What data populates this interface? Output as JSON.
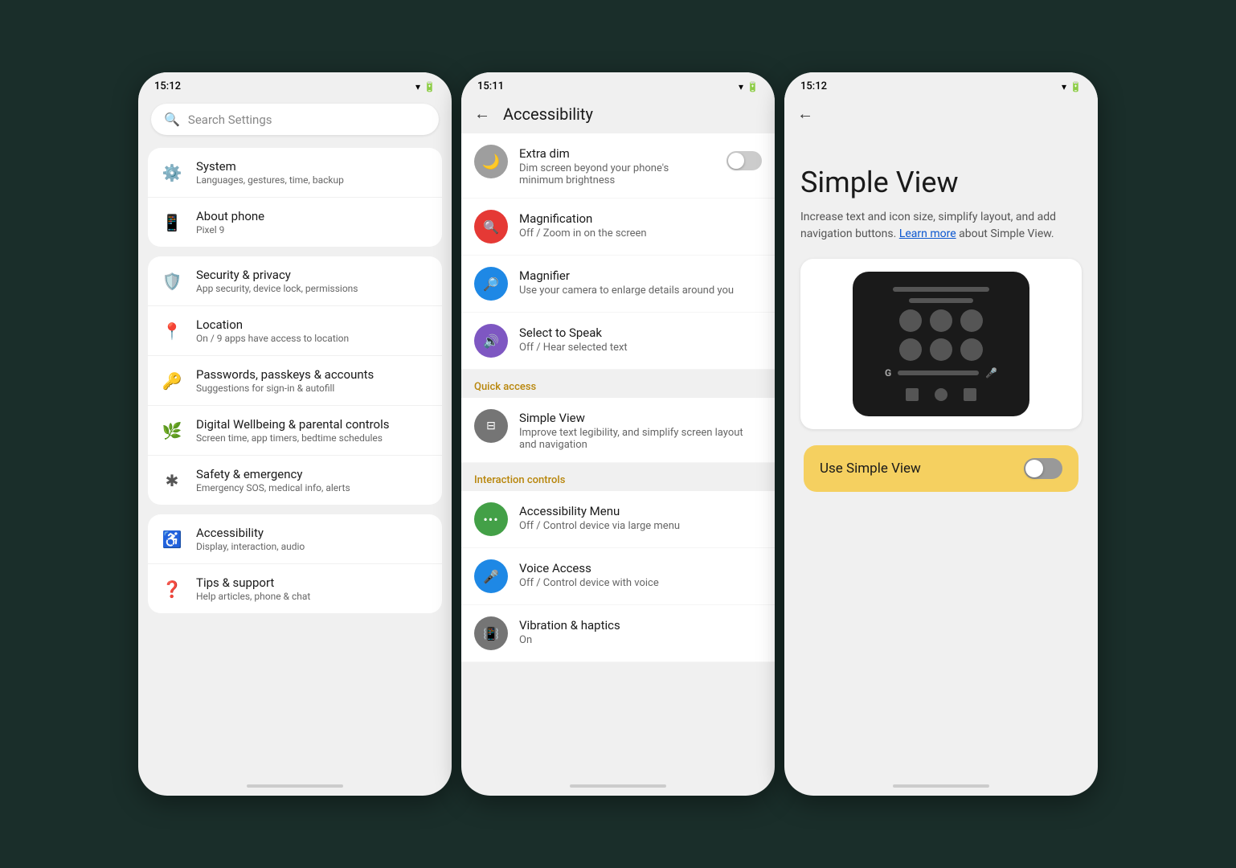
{
  "phone1": {
    "status_time": "15:12",
    "search_placeholder": "Search Settings",
    "items_group1": [
      {
        "icon": "⚙",
        "title": "System",
        "subtitle": "Languages, gestures, time, backup"
      },
      {
        "icon": "📱",
        "title": "About phone",
        "subtitle": "Pixel 9"
      }
    ],
    "items_group2": [
      {
        "icon": "🛡",
        "title": "Security & privacy",
        "subtitle": "App security, device lock, permissions"
      },
      {
        "icon": "📍",
        "title": "Location",
        "subtitle": "On / 9 apps have access to location"
      },
      {
        "icon": "🔑",
        "title": "Passwords, passkeys & accounts",
        "subtitle": "Suggestions for sign-in & autofill"
      },
      {
        "icon": "💚",
        "title": "Digital Wellbeing & parental controls",
        "subtitle": "Screen time, app timers, bedtime schedules"
      },
      {
        "icon": "✱",
        "title": "Safety & emergency",
        "subtitle": "Emergency SOS, medical info, alerts"
      }
    ],
    "items_group3": [
      {
        "icon": "♿",
        "title": "Accessibility",
        "subtitle": "Display, interaction, audio"
      },
      {
        "icon": "❓",
        "title": "Tips & support",
        "subtitle": "Help articles, phone & chat"
      }
    ]
  },
  "phone2": {
    "status_time": "15:11",
    "back_label": "←",
    "page_title": "Accessibility",
    "items": [
      {
        "icon": "🌙",
        "icon_bg": "#9e9e9e",
        "title": "Extra dim",
        "subtitle": "Dim screen beyond your phone's minimum brightness",
        "has_toggle": true,
        "toggle_state": "off"
      },
      {
        "icon": "🔍",
        "icon_bg": "#e53935",
        "title": "Magnification",
        "subtitle": "Off / Zoom in on the screen",
        "has_toggle": false
      },
      {
        "icon": "🔎",
        "icon_bg": "#1e88e5",
        "title": "Magnifier",
        "subtitle": "Use your camera to enlarge details around you",
        "has_toggle": false
      },
      {
        "icon": "🔊",
        "icon_bg": "#7e57c2",
        "title": "Select to Speak",
        "subtitle": "Off / Hear selected text",
        "has_toggle": false
      }
    ],
    "section_quick_access": "Quick access",
    "quick_access_items": [
      {
        "icon": "⊟",
        "icon_bg": "#757575",
        "title": "Simple View",
        "subtitle": "Improve text legibility, and simplify screen layout and navigation"
      }
    ],
    "section_interaction": "Interaction controls",
    "interaction_items": [
      {
        "icon": "⋯",
        "icon_bg": "#43a047",
        "title": "Accessibility Menu",
        "subtitle": "Off / Control device via large menu"
      },
      {
        "icon": "🎤",
        "icon_bg": "#1e88e5",
        "title": "Voice Access",
        "subtitle": "Off / Control device with voice"
      },
      {
        "icon": "📳",
        "icon_bg": "#757575",
        "title": "Vibration & haptics",
        "subtitle": "On"
      }
    ]
  },
  "phone3": {
    "status_time": "15:12",
    "back_label": "←",
    "page_title": "Simple View",
    "description": "Increase text and icon size, simplify layout, and add navigation buttons.",
    "learn_more_text": "Learn more",
    "description_suffix": "about Simple View.",
    "toggle_label": "Use Simple View",
    "toggle_state": "off"
  }
}
